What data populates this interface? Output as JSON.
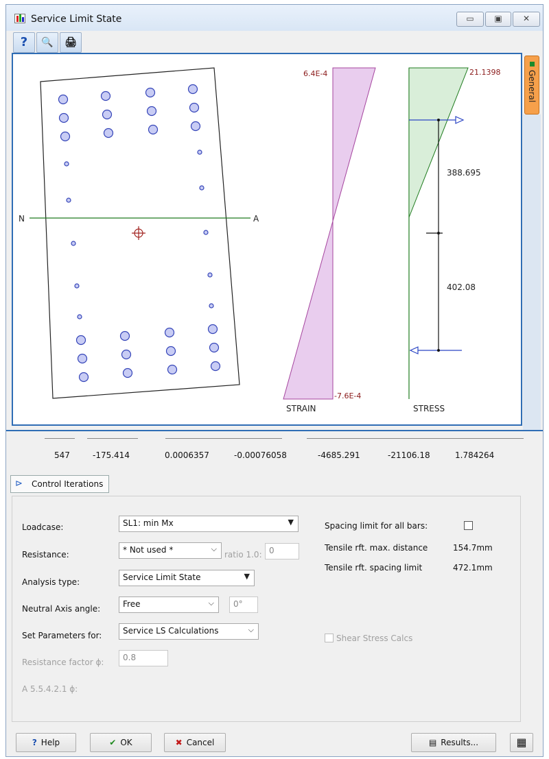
{
  "window": {
    "title": "Service Limit State",
    "min_btn": "▭",
    "max_btn": "▣",
    "close_btn": "✕"
  },
  "toolbar": {
    "help": "?",
    "preview": "🔍",
    "print": "🖨"
  },
  "side_tab": {
    "label": "General"
  },
  "diagram": {
    "axis_n": "N",
    "axis_a": "A",
    "strain_top": "6.4E-4",
    "strain_bottom": "-7.6E-4",
    "strain_label": "STRAIN",
    "stress_top": "21.1398",
    "stress_label": "STRESS",
    "dim_upper": "388.695",
    "dim_lower": "402.08"
  },
  "results": [
    "547",
    "-175.414",
    "0.0006357",
    "-0.00076058",
    "-4685.291",
    "-21106.18",
    "1.784264"
  ],
  "control_iterations": "Control Iterations",
  "form": {
    "loadcase_label": "Loadcase:",
    "loadcase_value": "SL1: min Mx",
    "resistance_label": "Resistance:",
    "resistance_value": "* Not used *",
    "ratio_label": "ratio 1.0:",
    "ratio_value": "0",
    "analysis_label": "Analysis type:",
    "analysis_value": "Service Limit State",
    "na_angle_label": "Neutral Axis angle:",
    "na_angle_value": "Free",
    "na_angle_deg": "0°",
    "set_params_label": "Set Parameters for:",
    "set_params_value": "Service LS Calculations",
    "res_factor_label": "Resistance factor ϕ:",
    "res_factor_value": "0.8",
    "article_label": "A 5.5.4.2.1 ϕ:",
    "spacing_label": "Spacing limit for all bars:",
    "tensile_dist_label": "Tensile rft. max. distance",
    "tensile_dist_value": "154.7mm",
    "tensile_spacing_label": "Tensile rft. spacing limit",
    "tensile_spacing_value": "472.1mm",
    "shear_label": "Shear Stress Calcs"
  },
  "footer": {
    "help": "Help",
    "ok": "OK",
    "cancel": "Cancel",
    "results": "Results...",
    "calc": "▦"
  }
}
